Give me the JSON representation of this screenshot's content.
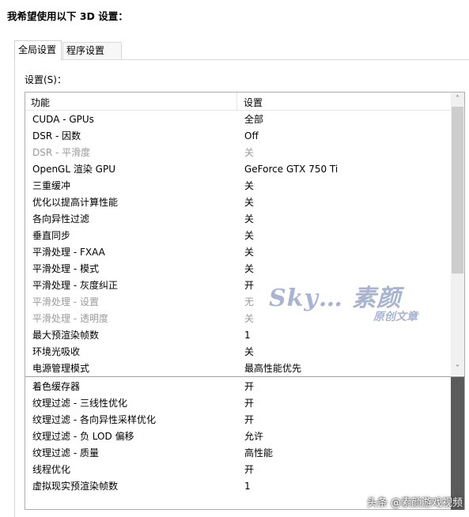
{
  "heading": "我希望使用以下 3D 设置：",
  "tabs": {
    "global": "全局设置",
    "program": "程序设置"
  },
  "settings_label": "设置(S)：",
  "columns": {
    "feature": "功能",
    "setting": "设置"
  },
  "rows": [
    {
      "name": "CUDA - GPUs",
      "value": "全部",
      "disabled": false
    },
    {
      "name": "DSR - 因数",
      "value": "Off",
      "disabled": false
    },
    {
      "name": "DSR - 平滑度",
      "value": "关",
      "disabled": true
    },
    {
      "name": "OpenGL 渲染 GPU",
      "value": "GeForce GTX 750 Ti",
      "disabled": false
    },
    {
      "name": "三重缓冲",
      "value": "关",
      "disabled": false
    },
    {
      "name": "优化以提高计算性能",
      "value": "关",
      "disabled": false
    },
    {
      "name": "各向异性过滤",
      "value": "关",
      "disabled": false
    },
    {
      "name": "垂直同步",
      "value": "关",
      "disabled": false
    },
    {
      "name": "平滑处理 - FXAA",
      "value": "关",
      "disabled": false
    },
    {
      "name": "平滑处理 - 模式",
      "value": "关",
      "disabled": false
    },
    {
      "name": "平滑处理 - 灰度纠正",
      "value": "开",
      "disabled": false
    },
    {
      "name": "平滑处理 - 设置",
      "value": "无",
      "disabled": true
    },
    {
      "name": "平滑处理 - 透明度",
      "value": "关",
      "disabled": true
    },
    {
      "name": "最大预渲染帧数",
      "value": "1",
      "disabled": false
    },
    {
      "name": "环境光吸收",
      "value": "关",
      "disabled": false
    },
    {
      "name": "电源管理模式",
      "value": "最高性能优先",
      "disabled": false
    }
  ],
  "rows2": [
    {
      "name": "着色缓存器",
      "value": "开"
    },
    {
      "name": "纹理过滤 - 三线性优化",
      "value": "开"
    },
    {
      "name": "纹理过滤 - 各向异性采样优化",
      "value": "开"
    },
    {
      "name": "纹理过滤 - 负 LOD 偏移",
      "value": "允许"
    },
    {
      "name": "纹理过滤 - 质量",
      "value": "高性能"
    },
    {
      "name": "线程优化",
      "value": "开"
    },
    {
      "name": "虚拟现实预渲染帧数",
      "value": "1"
    }
  ],
  "watermark": {
    "main": "Sky… 素颜",
    "sub": "原创文章"
  },
  "footer_watermark": "头条 @素颜游戏视频",
  "icons": {
    "scroll_up": "chevron-up-icon",
    "scroll_down": "chevron-down-icon"
  }
}
